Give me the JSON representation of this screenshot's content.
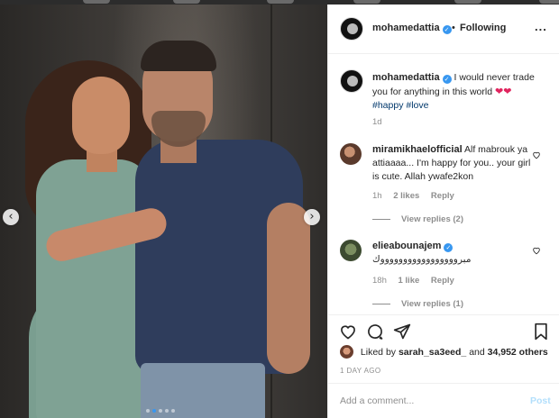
{
  "header": {
    "username": "mohamedattia",
    "separator": "•",
    "follow_status": "Following",
    "more_glyph": "..."
  },
  "caption": {
    "username": "mohamedattia",
    "text": "I would never trade you for anything in this world",
    "hearts": "❤❤",
    "hashtags": [
      "#happy",
      "#love"
    ],
    "time": "1d"
  },
  "comments": [
    {
      "username": "miramikhaelofficial",
      "text": "Alf mabrouk ya attiaaaa... I'm happy for you.. your girl is cute. Allah ywafe2kon",
      "time": "1h",
      "likes": "2 likes",
      "reply_label": "Reply",
      "view_replies": "View replies (2)"
    },
    {
      "username": "elieabounajem",
      "text": "مبروووووووووووووووووك",
      "time": "18h",
      "likes": "1 like",
      "reply_label": "Reply",
      "view_replies": "View replies (1)"
    }
  ],
  "likes_row": {
    "prefix": "Liked by",
    "user": "sarah_sa3eed_",
    "connector": "and",
    "count": "34,952 others"
  },
  "post_date": "1 DAY AGO",
  "add_comment": {
    "placeholder": "Add a comment...",
    "post_label": "Post"
  },
  "carousel": {
    "prev_glyph": "‹",
    "next_glyph": "›",
    "total": 5,
    "current": 2
  },
  "colors": {
    "verified_blue": "#3897f0",
    "heart_red": "#e0245e",
    "hashtag_blue": "#00376b",
    "post_button_disabled": "#b2dffc"
  },
  "icons": [
    "verified-badge-icon",
    "heart-outline-icon",
    "comment-icon",
    "share-icon",
    "bookmark-icon",
    "chevron-left-icon",
    "chevron-right-icon"
  ]
}
